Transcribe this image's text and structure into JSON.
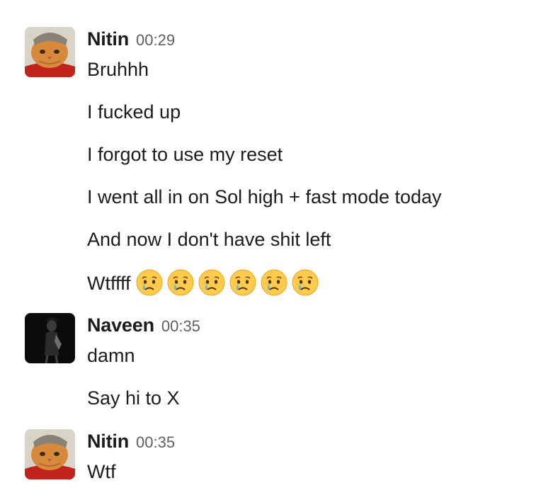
{
  "messages": [
    {
      "author": "Nitin",
      "time": "00:29",
      "avatar": "orange-cat-in-beanie",
      "lines": [
        "Bruhhh",
        "I fucked up",
        "I forgot to use my reset",
        "I went all in on Sol high + fast mode today",
        "And now I don't have shit left",
        "Wtffff"
      ],
      "emoji": [
        "crying-face",
        "crying-face",
        "crying-face",
        "crying-face",
        "crying-face",
        "crying-face"
      ]
    },
    {
      "author": "Naveen",
      "time": "00:35",
      "avatar": "dark-portrait",
      "lines": [
        "damn",
        "Say hi to X"
      ]
    },
    {
      "author": "Nitin",
      "time": "00:35",
      "avatar": "orange-cat-in-beanie",
      "lines": [
        "Wtf"
      ]
    }
  ],
  "colors": {
    "text": "#1d1c1d",
    "timestamp": "#616061"
  }
}
